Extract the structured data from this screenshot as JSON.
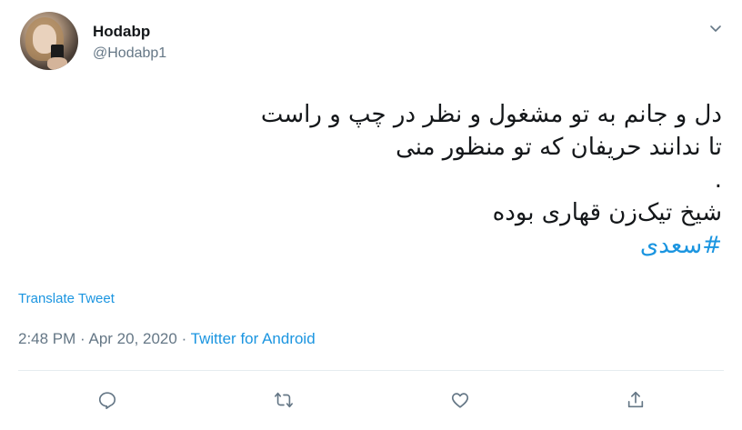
{
  "author": {
    "display_name": "Hodabp",
    "username": "@Hodabp1"
  },
  "tweet": {
    "lines": [
      "دل و جانم به تو مشغول و نظر در چپ و راست",
      "تا ندانند حریفان که تو منظور منی",
      ".",
      "شیخ تیک‌زن قهاری بوده"
    ],
    "hashtag": "#سعدی"
  },
  "translate_label": "Translate Tweet",
  "meta": {
    "time": "2:48 PM",
    "separator1": " · ",
    "date": "Apr 20, 2020",
    "separator2": " · ",
    "source": "Twitter for Android"
  },
  "actions": {
    "reply_icon": "reply-icon",
    "retweet_icon": "retweet-icon",
    "like_icon": "like-icon",
    "share_icon": "share-icon"
  },
  "colors": {
    "link": "#1b95e0",
    "secondary_text": "#657786",
    "primary_text": "#14171a",
    "divider": "#e6ecf0"
  }
}
